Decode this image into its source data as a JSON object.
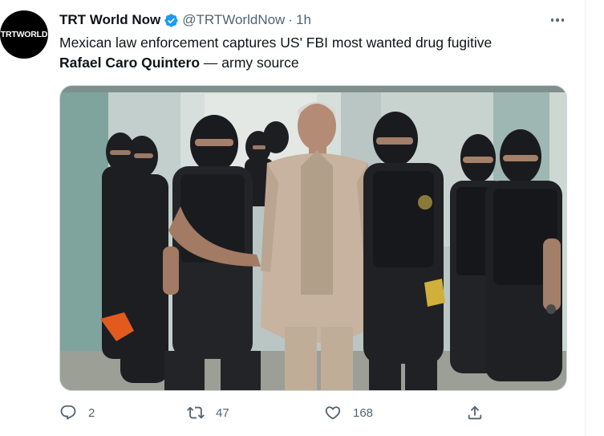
{
  "tweet": {
    "display_name": "TRT World Now",
    "verified": true,
    "handle": "@TRTWorldNow",
    "separator": "·",
    "time": "1h",
    "avatar_text": "TRTWORLD",
    "text_line1": "Mexican law enforcement captures US' FBI most wanted drug fugitive",
    "text_bold": "Rafael Caro Quintero",
    "text_rest": " — army source",
    "media_icon": "photo",
    "colors": {
      "verified": "#1d9bf0",
      "secondary_text": "#536471",
      "primary_text": "#0f1419",
      "border": "#cfd9de"
    }
  },
  "actions": {
    "reply_count": "2",
    "retweet_count": "47",
    "like_count": "168",
    "reply_icon": "reply-icon",
    "retweet_icon": "retweet-icon",
    "like_icon": "heart-icon",
    "share_icon": "share-icon"
  }
}
